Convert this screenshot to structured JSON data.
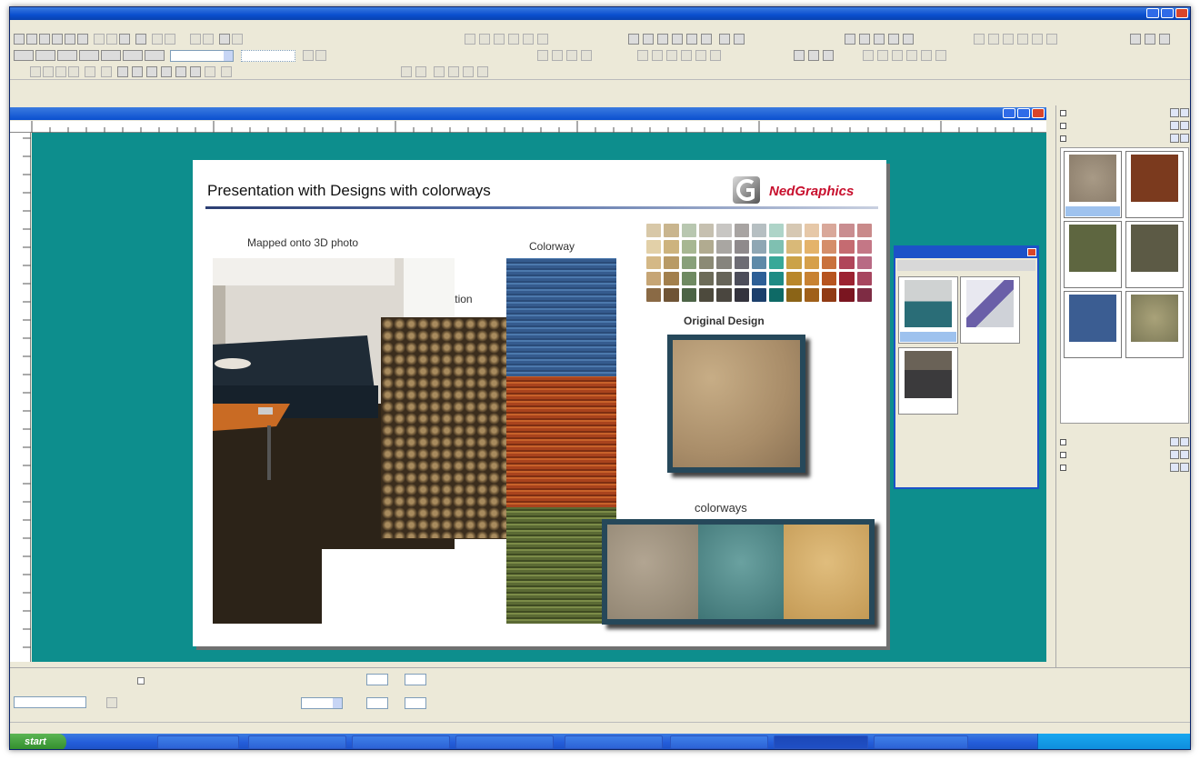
{
  "app": {
    "title": "",
    "menus": [
      "",
      "",
      "",
      "",
      "",
      "",
      "",
      "",
      ""
    ]
  },
  "toolbar": {
    "zoom_value": "",
    "style_value": "",
    "view_tabs": [
      "",
      "",
      "",
      "",
      ""
    ]
  },
  "document": {
    "window_title": "",
    "ruler_labels": [
      "",
      "",
      "",
      "",
      "",
      ""
    ]
  },
  "slide": {
    "title": "Presentation with Designs with colorways",
    "logo_text": "NedGraphics",
    "label_mapped": "Mapped onto 3D photo",
    "label_tuft": "Tuft simulation",
    "label_colorway": "Colorway",
    "label_original": "Original Design",
    "label_colorways": "colorways",
    "palette": [
      "#d8c8a8",
      "#c9b58e",
      "#b8c7b0",
      "#c6c0b0",
      "#c8c6c3",
      "#a8a4a2",
      "#b6bfc2",
      "#aed4c8",
      "#d6c8b3",
      "#e6c8a8",
      "#d9a89a",
      "#c98d90",
      "#c98a8a",
      "#e2d0a8",
      "#cdb37e",
      "#a7b792",
      "#b1ab90",
      "#a9a6a2",
      "#8f8a8c",
      "#8fa7b4",
      "#7fc0b1",
      "#d9b978",
      "#e4b36a",
      "#d58e6a",
      "#c56b71",
      "#c47786",
      "#d4b886",
      "#b89a66",
      "#88a07a",
      "#8b8a75",
      "#86847d",
      "#6d6c74",
      "#5e8aa8",
      "#38a898",
      "#cba248",
      "#d6a04a",
      "#c9713d",
      "#b0455a",
      "#b86a84",
      "#c6a575",
      "#a27f4c",
      "#6f8a62",
      "#6c6b58",
      "#666459",
      "#4c4d5a",
      "#2d5f96",
      "#1e8b84",
      "#b9872b",
      "#c88232",
      "#b7541f",
      "#9c2231",
      "#a7465f",
      "#8a6a45",
      "#6f5436",
      "#4c6446",
      "#4d4a3d",
      "#4a463f",
      "#34333d",
      "#1c3f6c",
      "#0e6a66",
      "#8b6417",
      "#a0601a",
      "#913b14",
      "#7a1520",
      "#7e2c44"
    ]
  },
  "browser": {
    "title": "",
    "book": "",
    "items": [
      "",
      "",
      ""
    ]
  },
  "side_panel": {
    "sections_top": [
      "",
      "",
      ""
    ],
    "fabrics": [
      "",
      "",
      "",
      "",
      "",
      ""
    ],
    "sections_bottom": [
      "",
      "",
      ""
    ]
  },
  "properties": {
    "checkbox_label": "",
    "page_label": "",
    "value_a": "",
    "field_w": "",
    "field_x": "",
    "field_h": "",
    "field_y": "",
    "dim_combo": ""
  },
  "status": {
    "left": "",
    "right": ""
  },
  "taskbar": {
    "start": "start",
    "tasks": [
      "",
      "",
      "",
      "",
      "",
      "",
      "",
      "",
      ""
    ],
    "clock": ""
  }
}
